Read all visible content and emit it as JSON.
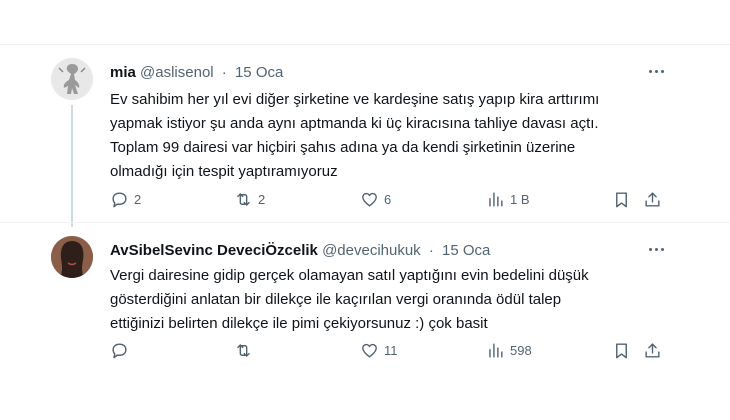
{
  "tweets": [
    {
      "author_name": "mia",
      "handle": "@aslisenol",
      "separator": "·",
      "date": "15 Oca",
      "text_lines": [
        "Ev sahibim her yıl evi diğer şirketine ve kardeşine satış yapıp kira arttırımı",
        "yapmak istiyor şu anda aynı aptmanda ki üç kiracısına tahliye davası açtı.",
        "Toplam 99 dairesi var hiçbiri şahıs adına ya da kendi şirketinin üzerine",
        "olmadığı için tespit yaptıramıyoruz"
      ],
      "replies": "2",
      "retweets": "2",
      "likes": "6",
      "views": "1 B"
    },
    {
      "author_name": "AvSibelSevinc DeveciÖzcelik",
      "handle": "@devecihukuk",
      "separator": "·",
      "date": "15 Oca",
      "text_lines": [
        "Vergi dairesine gidip gerçek olamayan satıl yaptığını evin bedelini düşük",
        "gösterdiğini anlatan bir dilekçe ile kaçırılan vergi oranında ödül talep",
        "ettiğinizi belirten dilekçe ile pimi çekiyorsunuz :) çok basit"
      ],
      "replies": "",
      "retweets": "",
      "likes": "11",
      "views": "598"
    }
  ],
  "icons": {
    "reply": "reply-icon",
    "retweet": "retweet-icon",
    "like": "heart-icon",
    "views": "views-chart-icon",
    "bookmark": "bookmark-icon",
    "share": "share-icon",
    "more": "more-icon"
  },
  "colors": {
    "text": "#0f1419",
    "secondary": "#536471",
    "thread_line": "#cfd9de",
    "divider": "#eff3f4"
  }
}
